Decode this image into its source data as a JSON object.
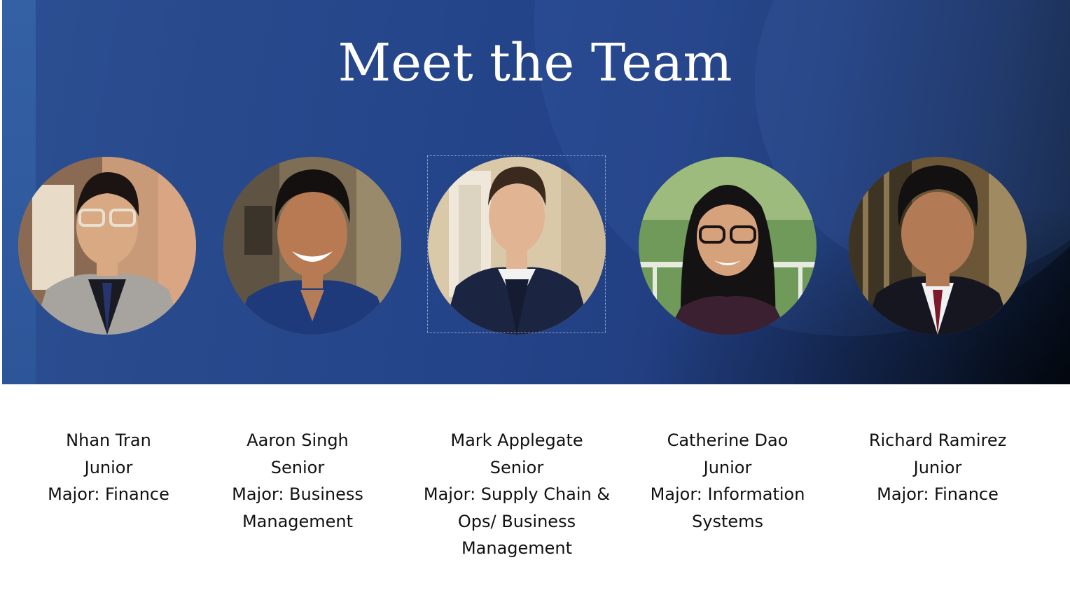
{
  "slide": {
    "title": "Meet the Team",
    "colors": {
      "banner": "#24448a",
      "banner_dark": "#06101f",
      "title_text": "#ffffff",
      "caption_text": "#111111"
    }
  },
  "members": [
    {
      "name": "Nhan Tran",
      "year": "Junior",
      "major_lines": [
        "Major: Finance"
      ],
      "photo_icon": "portrait-photo"
    },
    {
      "name": "Aaron Singh",
      "year": "Senior",
      "major_lines": [
        "Major: Business",
        "Management"
      ],
      "photo_icon": "portrait-photo"
    },
    {
      "name": "Mark Applegate",
      "year": "Senior",
      "major_lines": [
        "Major: Supply Chain &",
        "Ops/ Business",
        "Management"
      ],
      "photo_icon": "portrait-photo"
    },
    {
      "name": "Catherine Dao",
      "year": "Junior",
      "major_lines": [
        "Major: Information",
        "Systems"
      ],
      "photo_icon": "portrait-photo"
    },
    {
      "name": "Richard Ramirez",
      "year": "Junior",
      "major_lines": [
        "Major: Finance"
      ],
      "photo_icon": "portrait-photo"
    }
  ]
}
